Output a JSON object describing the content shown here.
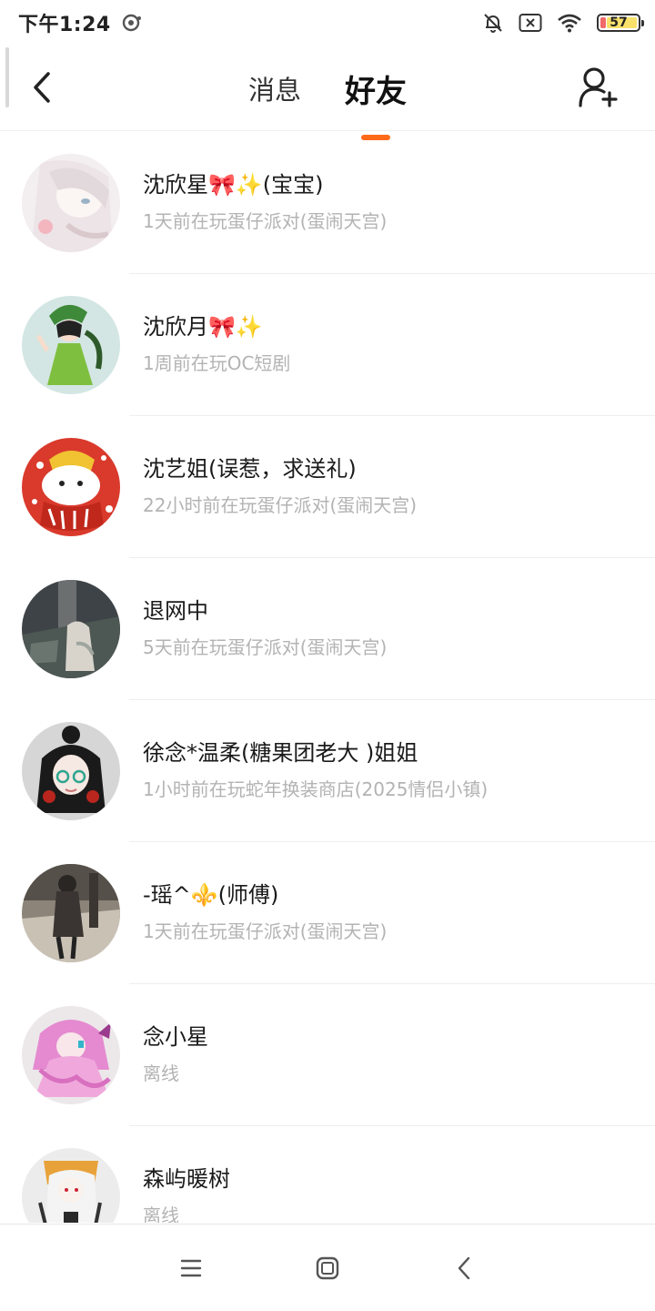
{
  "status_bar": {
    "time": "下午1:24",
    "battery": "57"
  },
  "header": {
    "tabs": [
      {
        "label": "消息",
        "active": false
      },
      {
        "label": "好友",
        "active": true
      }
    ],
    "accent_color": "#ff6a1a"
  },
  "friends": [
    {
      "name": "沈欣星🎀✨(宝宝)",
      "status": "1天前在玩蛋仔派对(蛋闹天宫)"
    },
    {
      "name": "沈欣月🎀✨",
      "status": "1周前在玩OC短剧"
    },
    {
      "name": "沈艺姐(误惹，求送礼)",
      "status": "22小时前在玩蛋仔派对(蛋闹天宫)"
    },
    {
      "name": "退网中",
      "status": "5天前在玩蛋仔派对(蛋闹天宫)"
    },
    {
      "name": "徐念*温柔(糖果团老大 )姐姐",
      "status": "1小时前在玩蛇年换装商店(2025情侣小镇)"
    },
    {
      "name": "-瑶^⚜️(师傅)",
      "status": "1天前在玩蛋仔派对(蛋闹天宫)"
    },
    {
      "name": "念小星",
      "status": "离线"
    },
    {
      "name": "森屿暖树",
      "status": "离线"
    }
  ]
}
